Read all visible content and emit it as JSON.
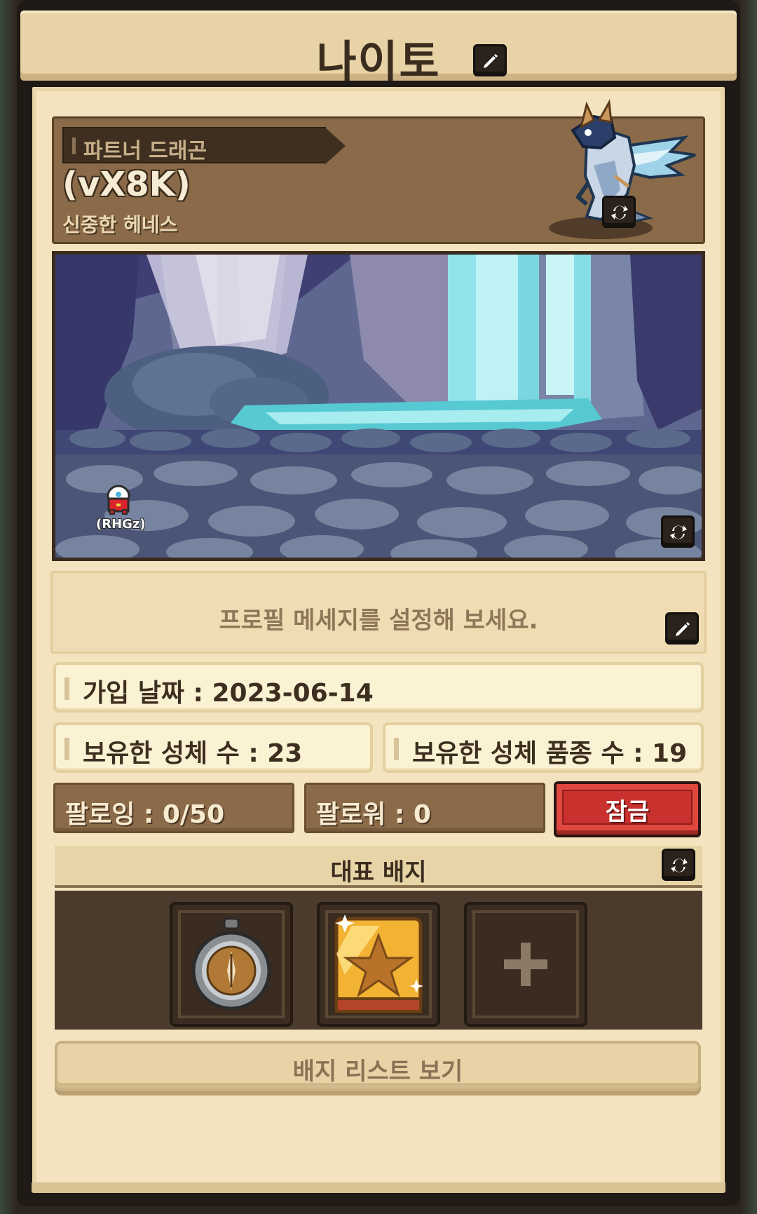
{
  "header": {
    "title": "나이토"
  },
  "partner": {
    "tag": "파트너 드래곤",
    "name": "(vX8K)",
    "subtitle": "신중한 헤네스"
  },
  "scene": {
    "pet_label": "(RHGz)"
  },
  "profile": {
    "message_placeholder": "프로필 메세지를 설정해 보세요."
  },
  "stats": {
    "join_date": "가입 날짜 : 2023-06-14",
    "owned_count": "보유한 성체 수 : 23",
    "owned_species": "보유한 성체 품종 수 : 19"
  },
  "social": {
    "following": "팔로잉 : 0/50",
    "followers": "팔로워 : 0",
    "lock_label": "잠금"
  },
  "badges": {
    "title": "대표 배지",
    "slots": [
      "compass-badge",
      "star-book-badge",
      "empty-slot"
    ],
    "list_button": "배지 리스트 보기"
  },
  "colors": {
    "panel": "#f3e4bf",
    "partner_bg": "#8a6a48",
    "lock_red": "#e0483f",
    "dark_frame": "#1e1914"
  }
}
